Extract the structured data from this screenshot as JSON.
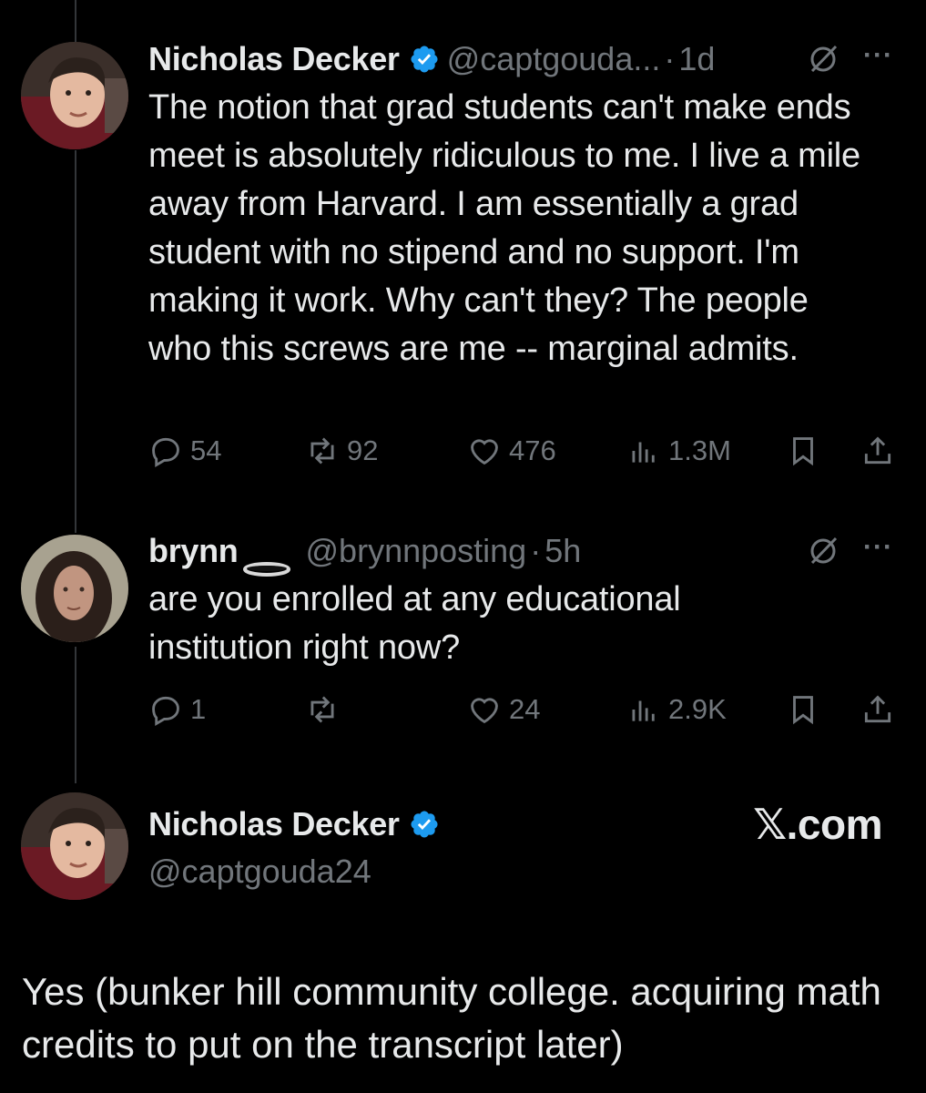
{
  "tweet1": {
    "name": "Nicholas Decker",
    "handle": "@captgouda...",
    "time": "1d",
    "text": "The notion that grad students can't make ends meet is absolutely ridiculous to me. I live a mile away from Harvard. I am essentially a grad student with no stipend and no support. I'm making it work. Why can't they? The people who this screws are me -- marginal admits.",
    "replies": "54",
    "reposts": "92",
    "likes": "476",
    "views": "1.3M"
  },
  "tweet2": {
    "name": "brynn",
    "handle": "@brynnposting",
    "time": "5h",
    "text": "are you enrolled at any educational institution right now?",
    "replies": "1",
    "reposts": "",
    "likes": "24",
    "views": "2.9K"
  },
  "tweet3": {
    "name": "Nicholas Decker",
    "handle": "@captgouda24",
    "brand": "𝕏.com",
    "text": "Yes (bunker hill community college. acquiring math credits to put on the transcript later)"
  },
  "colors": {
    "background": "#000000",
    "text": "#e7e9ea",
    "muted": "#71767b",
    "verified": "#1d9bf0"
  }
}
